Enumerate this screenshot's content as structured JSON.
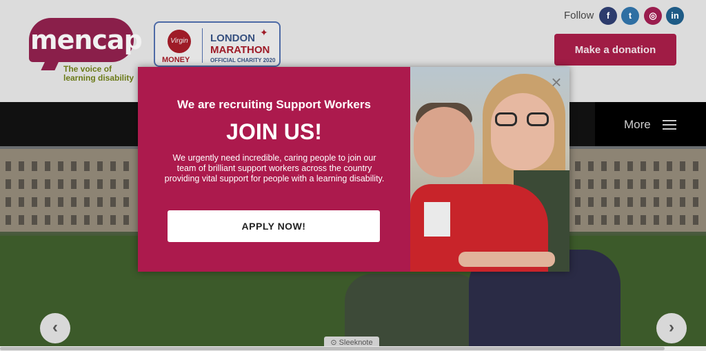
{
  "header": {
    "logo_text": "mencap",
    "tagline_line1": "The voice of",
    "tagline_line2": "learning disability",
    "partner": {
      "virgin": "Virgin",
      "money": "MONEY",
      "london": "LONDON",
      "marathon": "MARATHON",
      "official": "OFFICIAL CHARITY  2020"
    },
    "follow_label": "Follow",
    "social": [
      {
        "name": "facebook-icon",
        "glyph": "f"
      },
      {
        "name": "twitter-icon",
        "glyph": "t"
      },
      {
        "name": "instagram-icon",
        "glyph": "◎"
      },
      {
        "name": "linkedin-icon",
        "glyph": "in"
      }
    ],
    "donate_label": "Make a donation"
  },
  "nav": {
    "more_label": "More"
  },
  "hero": {
    "prev_glyph": "‹",
    "next_glyph": "›",
    "sleeknote_label": "Sleeknote"
  },
  "popup": {
    "kicker": "We are recruiting Support Workers",
    "title": "JOIN US!",
    "body": "We urgently need incredible, caring people to join our team of brilliant support workers across the country providing vital support for people with a learning disability.",
    "cta_label": "APPLY NOW!",
    "close_glyph": "×"
  },
  "colors": {
    "brand": "#ac1a4d",
    "donate": "#a01c45",
    "nav": "#111111"
  }
}
